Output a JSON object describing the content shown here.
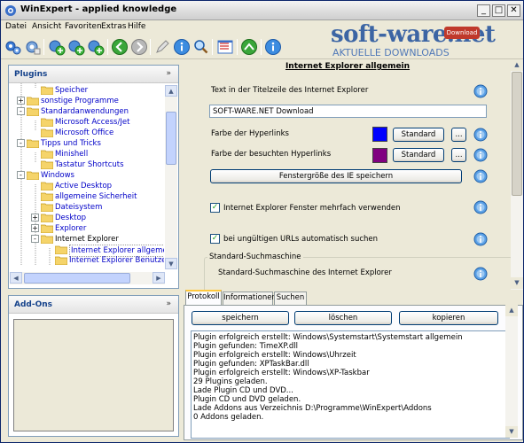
{
  "window": {
    "title": "WinExpert - applied knowledge",
    "controls": {
      "minimize": "_",
      "maximize": "□",
      "close": "✕"
    }
  },
  "menu": [
    {
      "label": "Datei",
      "accel_index": 0
    },
    {
      "label": "Ansicht",
      "accel_index": 0
    },
    {
      "label": "Favoriten",
      "accel_index": 0
    },
    {
      "label": "Extras",
      "accel_index": 0
    },
    {
      "label": "Hilfe",
      "accel_index": 0
    }
  ],
  "toolbar": {
    "buttons": [
      "gears-icon",
      "gear-settings-icon",
      "add-green-icon",
      "add-blue-icon",
      "add-cyan-icon",
      "back-arrow-icon",
      "forward-arrow-icon",
      "pencil-icon",
      "info-icon",
      "search-icon",
      "list-icon",
      "go-icon",
      "help-icon"
    ]
  },
  "watermark": {
    "brand": "soft-ware.net",
    "tagline": "AKTUELLE DOWNLOADS",
    "badge": "Download"
  },
  "plugins_pane": {
    "title": "Plugins",
    "collapse_glyph": "»",
    "tree": [
      {
        "label": "Speicher",
        "level": 1,
        "expander": "",
        "color": "blue"
      },
      {
        "label": "sonstige Programme",
        "level": 0,
        "expander": "+",
        "color": "blue"
      },
      {
        "label": "Standardanwendungen",
        "level": 0,
        "expander": "-",
        "color": "blue"
      },
      {
        "label": "Microsoft Access/Jet",
        "level": 1,
        "expander": "",
        "color": "blue"
      },
      {
        "label": "Microsoft Office",
        "level": 1,
        "expander": "",
        "color": "blue"
      },
      {
        "label": "Tipps und Tricks",
        "level": 0,
        "expander": "-",
        "color": "blue"
      },
      {
        "label": "Minishell",
        "level": 1,
        "expander": "",
        "color": "blue"
      },
      {
        "label": "Tastatur Shortcuts",
        "level": 1,
        "expander": "",
        "color": "blue"
      },
      {
        "label": "Windows",
        "level": 0,
        "expander": "-",
        "color": "blue"
      },
      {
        "label": "Active Desktop",
        "level": 1,
        "expander": "",
        "color": "blue"
      },
      {
        "label": "allgemeine Sicherheit",
        "level": 1,
        "expander": "",
        "color": "blue"
      },
      {
        "label": "Dateisystem",
        "level": 1,
        "expander": "",
        "color": "blue"
      },
      {
        "label": "Desktop",
        "level": 1,
        "expander": "+",
        "color": "blue"
      },
      {
        "label": "Explorer",
        "level": 1,
        "expander": "+",
        "color": "blue"
      },
      {
        "label": "Internet Explorer",
        "level": 1,
        "expander": "-",
        "color": "black"
      },
      {
        "label": "Internet Explorer allgemein",
        "level": 2,
        "expander": "",
        "color": "blue",
        "selected": true
      },
      {
        "label": "Internet Explorer Benutzer",
        "level": 2,
        "expander": "",
        "color": "blue"
      }
    ]
  },
  "addons_pane": {
    "title": "Add-Ons",
    "collapse_glyph": "»"
  },
  "settings": {
    "title": "Internet Explorer allgemein",
    "title_bar_label": "Text in der Titelzeile des Internet Explorer",
    "title_bar_value": "SOFT-WARE.NET Download",
    "link_color_label": "Farbe der Hyperlinks",
    "link_color": "#0000ff",
    "visited_color_label": "Farbe der besuchten Hyperlinks",
    "visited_color": "#800080",
    "standard_label": "Standard",
    "ellipsis_label": "...",
    "save_size_button": "Fenstergröße des IE speichern",
    "reuse_windows_label": "Internet Explorer Fenster mehrfach verwenden",
    "reuse_windows_checked": true,
    "autosearch_label": "bei ungültigen URLs automatisch suchen",
    "autosearch_checked": true,
    "search_group_title": "Standard-Suchmaschine",
    "search_group_label": "Standard-Suchmaschine des Internet Explorer"
  },
  "bottom": {
    "tabs": [
      {
        "label": "Protokoll",
        "active": true
      },
      {
        "label": "Informationen",
        "active": false
      },
      {
        "label": "Suchen",
        "active": false
      }
    ],
    "save_button": "speichern",
    "delete_button": "löschen",
    "copy_button": "kopieren",
    "log": [
      "Plugin erfolgreich erstellt: Windows\\Systemstart\\Systemstart allgemein",
      "Plugin gefunden: TimeXP.dll",
      "Plugin erfolgreich erstellt: Windows\\Uhrzeit",
      "Plugin gefunden: XPTaskBar.dll",
      "Plugin erfolgreich erstellt: Windows\\XP-Taskbar",
      "29 Plugins geladen.",
      "Lade Plugin CD und DVD...",
      "Plugin CD und DVD geladen.",
      "Lade Addons aus Verzeichnis D:\\Programme\\WinExpert\\Addons",
      "0 Addons geladen."
    ]
  }
}
